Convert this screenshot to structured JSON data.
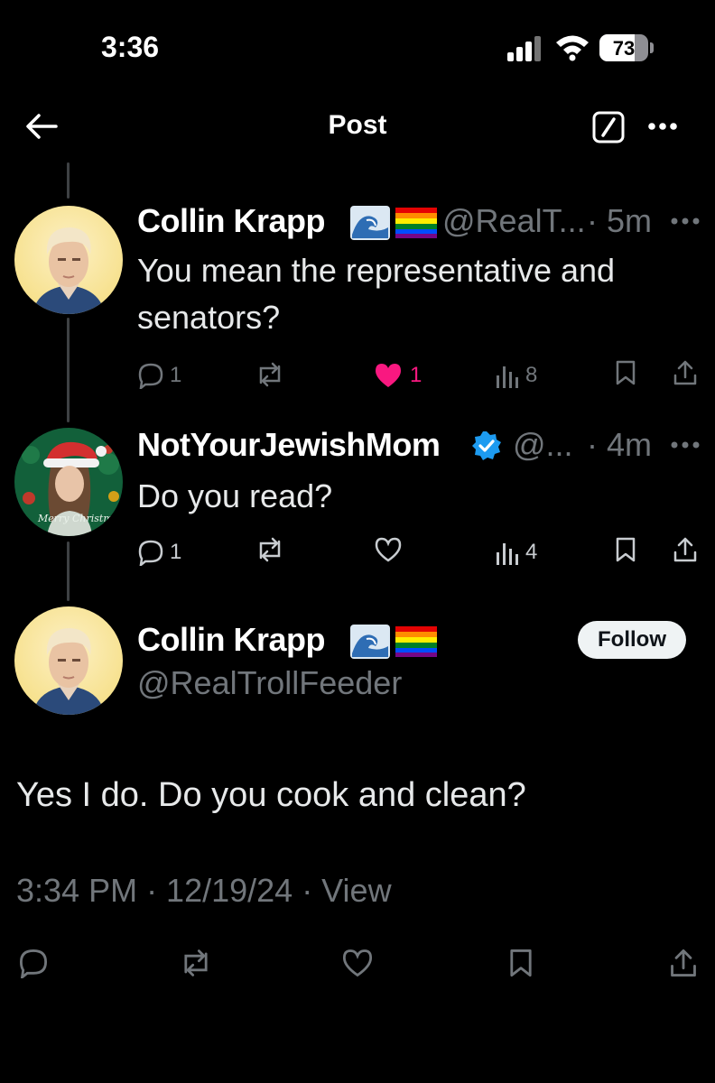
{
  "status": {
    "time": "3:36",
    "battery": "73",
    "battery_level": 0.73
  },
  "header": {
    "title": "Post"
  },
  "replies": [
    {
      "name": "Collin Krapp",
      "emoji": "🌊🏳️‍🌈",
      "handle": "@RealT...",
      "age": "· 5m",
      "text": "You mean the representative and senators?",
      "replies": "1",
      "likes": "1",
      "views": "8"
    },
    {
      "name": "NotYourJewishMom",
      "handle": "@...",
      "age": "· 4m",
      "text": "Do you read?",
      "replies": "1",
      "views": "4",
      "avatar_caption": "Merry Christmas"
    }
  ],
  "main_post": {
    "name": "Collin Krapp",
    "handle": "@RealTrollFeeder",
    "follow_label": "Follow",
    "text": "Yes I do. Do you cook and clean?",
    "meta": "3:34 PM · 12/19/24 · View"
  },
  "colors": {
    "background": "#000000",
    "muted": "#71767b",
    "like": "#f91880",
    "verified": "#1d9bf0"
  }
}
